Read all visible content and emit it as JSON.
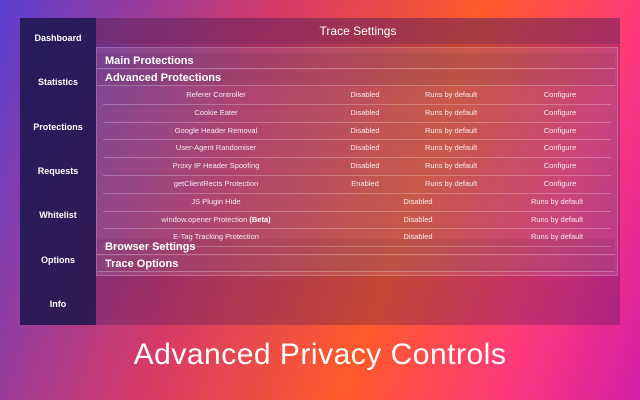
{
  "app": {
    "title": "Trace Settings"
  },
  "sidebar": {
    "items": [
      {
        "label": "Dashboard"
      },
      {
        "label": "Statistics"
      },
      {
        "label": "Protections"
      },
      {
        "label": "Requests"
      },
      {
        "label": "Whitelist"
      },
      {
        "label": "Options"
      },
      {
        "label": "Info"
      }
    ]
  },
  "sections": {
    "main": "Main Protections",
    "advanced": "Advanced Protections",
    "browser": "Browser Settings",
    "trace": "Trace Options"
  },
  "advanced_rows": [
    {
      "name": "Referer Controller",
      "status": "Disabled",
      "default": "Runs by default",
      "action": "Configure"
    },
    {
      "name": "Cookie Eater",
      "status": "Disabled",
      "default": "Runs by default",
      "action": "Configure"
    },
    {
      "name": "Google Header Removal",
      "status": "Disabled",
      "default": "Runs by default",
      "action": "Configure"
    },
    {
      "name": "User-Agent Randomiser",
      "status": "Disabled",
      "default": "Runs by default",
      "action": "Configure"
    },
    {
      "name": "Proxy IP Header Spoofing",
      "status": "Disabled",
      "default": "Runs by default",
      "action": "Configure"
    },
    {
      "name": "getClientRects Protection",
      "status": "Enabled",
      "default": "Runs by default",
      "action": "Configure"
    },
    {
      "name": "JS Plugin Hide",
      "status": "Disabled",
      "default": "Runs by default"
    },
    {
      "name": "window.opener Protection",
      "badge": "(Beta)",
      "status": "Disabled",
      "default": "Runs by default"
    },
    {
      "name": "E-Tag Tracking Protection",
      "status": "Disabled",
      "default": "Runs by default"
    }
  ],
  "caption": "Advanced Privacy Controls"
}
